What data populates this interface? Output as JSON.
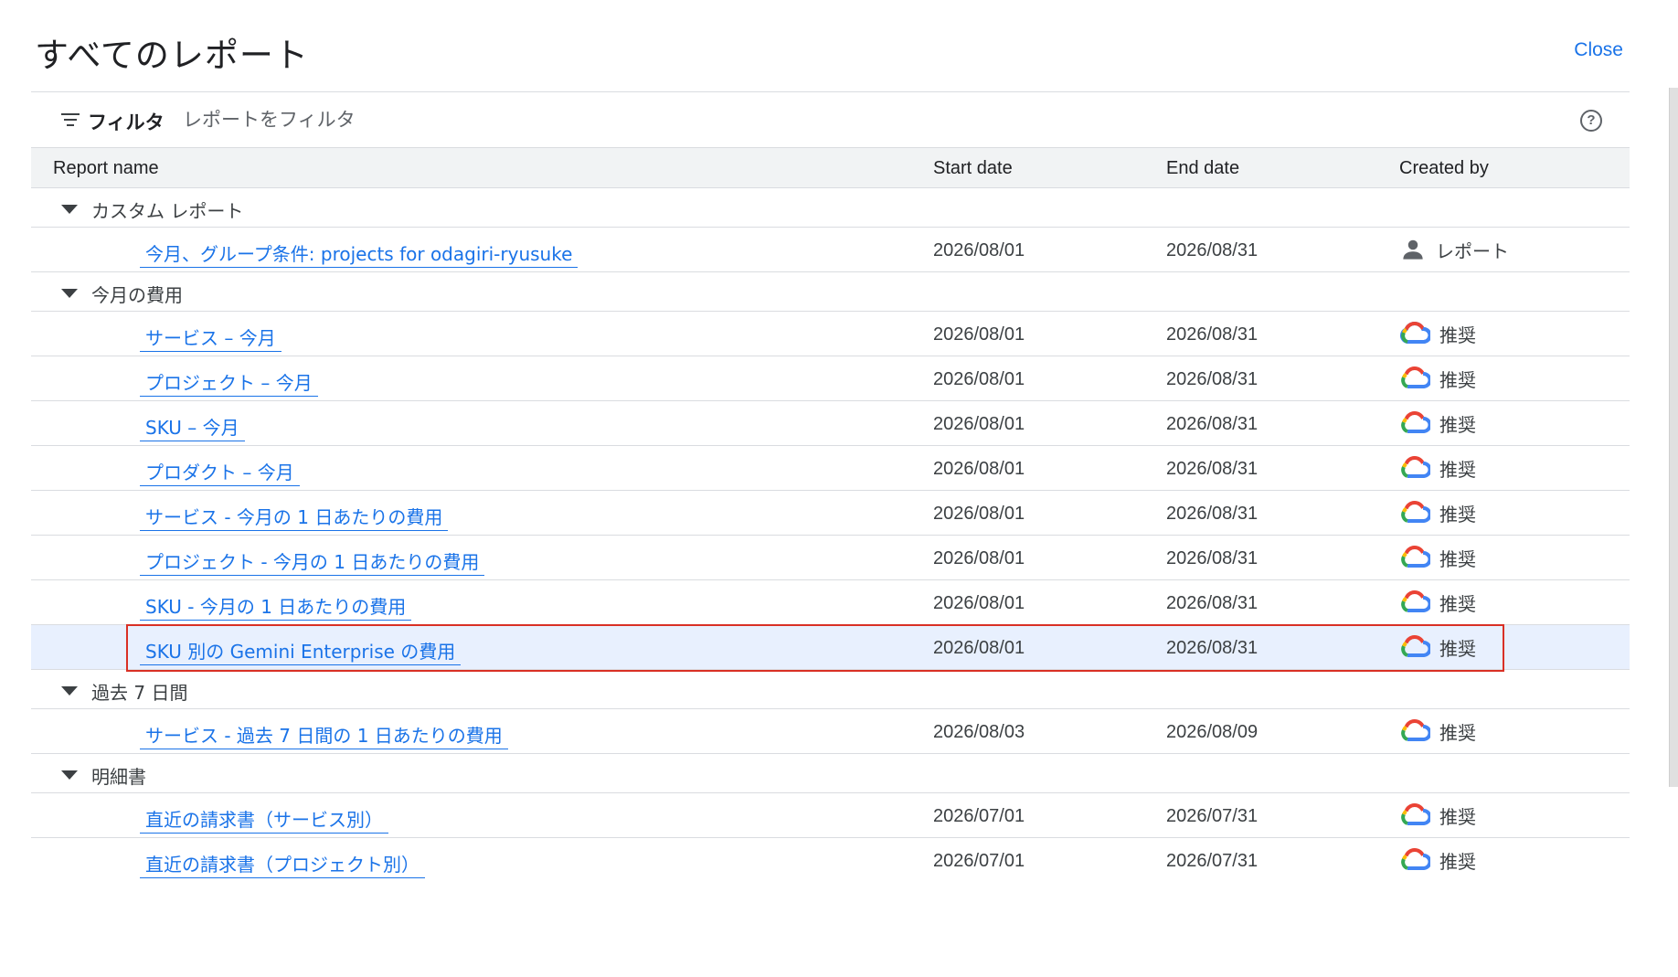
{
  "page": {
    "title": "すべてのレポート",
    "close_label": "Close"
  },
  "filter": {
    "label": "フィルタ",
    "placeholder": "レポートをフィルタ",
    "help_icon": "help-circle-icon"
  },
  "table": {
    "headers": {
      "report_name": "Report name",
      "start_date": "Start date",
      "end_date": "End date",
      "created_by": "Created by"
    },
    "groups": [
      {
        "label": "カスタム レポート",
        "rows": [
          {
            "name": "今月、グループ条件: projects for odagiri-ryusuke",
            "start": "2026/08/01",
            "end": "2026/08/31",
            "creator": "レポート",
            "creator_icon": "person-icon"
          }
        ]
      },
      {
        "label": "今月の費用",
        "rows": [
          {
            "name": "サービス – 今月",
            "start": "2026/08/01",
            "end": "2026/08/31",
            "creator": "推奨",
            "creator_icon": "google-cloud-icon"
          },
          {
            "name": "プロジェクト – 今月",
            "start": "2026/08/01",
            "end": "2026/08/31",
            "creator": "推奨",
            "creator_icon": "google-cloud-icon"
          },
          {
            "name": "SKU – 今月",
            "start": "2026/08/01",
            "end": "2026/08/31",
            "creator": "推奨",
            "creator_icon": "google-cloud-icon"
          },
          {
            "name": "プロダクト – 今月",
            "start": "2026/08/01",
            "end": "2026/08/31",
            "creator": "推奨",
            "creator_icon": "google-cloud-icon"
          },
          {
            "name": "サービス - 今月の 1 日あたりの費用",
            "start": "2026/08/01",
            "end": "2026/08/31",
            "creator": "推奨",
            "creator_icon": "google-cloud-icon"
          },
          {
            "name": "プロジェクト - 今月の 1 日あたりの費用",
            "start": "2026/08/01",
            "end": "2026/08/31",
            "creator": "推奨",
            "creator_icon": "google-cloud-icon"
          },
          {
            "name": "SKU - 今月の 1 日あたりの費用",
            "start": "2026/08/01",
            "end": "2026/08/31",
            "creator": "推奨",
            "creator_icon": "google-cloud-icon"
          },
          {
            "name": "SKU 別の Gemini Enterprise の費用",
            "start": "2026/08/01",
            "end": "2026/08/31",
            "creator": "推奨",
            "creator_icon": "google-cloud-icon",
            "selected": true
          }
        ]
      },
      {
        "label": "過去 7 日間",
        "rows": [
          {
            "name": "サービス - 過去 7 日間の 1 日あたりの費用",
            "start": "2026/08/03",
            "end": "2026/08/09",
            "creator": "推奨",
            "creator_icon": "google-cloud-icon"
          }
        ]
      },
      {
        "label": "明細書",
        "rows": [
          {
            "name": "直近の請求書（サービス別）",
            "start": "2026/07/01",
            "end": "2026/07/31",
            "creator": "推奨",
            "creator_icon": "google-cloud-icon"
          },
          {
            "name": "直近の請求書（プロジェクト別）",
            "start": "2026/07/01",
            "end": "2026/07/31",
            "creator": "推奨",
            "creator_icon": "google-cloud-icon"
          }
        ]
      }
    ]
  },
  "colors": {
    "link": "#1a73e8",
    "highlight_border": "#d93025",
    "selected_row": "#e8f0fe",
    "header_bg": "#f1f3f4"
  }
}
